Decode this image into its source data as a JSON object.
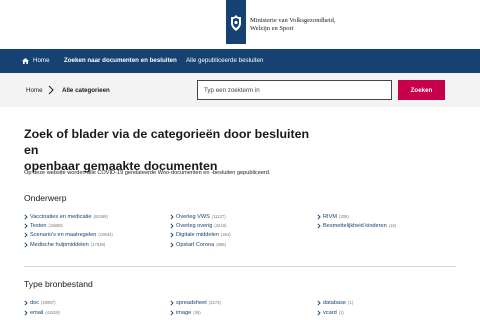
{
  "header": {
    "ministry_line1": "Ministerie van Volksgezondheid,",
    "ministry_line2": "Welzijn en Sport"
  },
  "nav": {
    "home": "Home",
    "search": "Zoeken naar documenten en besluiten",
    "all_published": "Alle gepubliceerde besluiten"
  },
  "breadcrumb": {
    "home": "Home",
    "current": "Alle categorieen"
  },
  "search": {
    "placeholder": "Typ een zoekterm in",
    "button": "Zoeken"
  },
  "main": {
    "title_line1": "Zoek of blader via de categorieën door besluiten en",
    "title_line2": "openbaar gemaakte documenten",
    "intro": "Op deze website worden alle COVID-19 gerelateerde Woo-documenten en -besluiten gepubliceerd."
  },
  "onderwerp": {
    "heading": "Onderwerp",
    "items": [
      {
        "label": "Vaccinaties en medicatie",
        "count": "(62459)"
      },
      {
        "label": "Testen",
        "count": "(15858)"
      },
      {
        "label": "Scenario's en maatregelen",
        "count": "(10944)"
      },
      {
        "label": "Medische hulpmiddelen",
        "count": "(17539)"
      },
      {
        "label": "Overleg VWS",
        "count": "(11127)"
      },
      {
        "label": "Overleg overig",
        "count": "(3219)"
      },
      {
        "label": "Digitale middelen",
        "count": "(464)"
      },
      {
        "label": "Opstart Corona",
        "count": "(856)"
      },
      {
        "label": "RIVM",
        "count": "(209)"
      },
      {
        "label": "Besmettelijkheid kinderen",
        "count": "(16)"
      }
    ]
  },
  "bronbestand": {
    "heading": "Type bronbestand",
    "items": [
      {
        "label": "doc",
        "count": "(40897)"
      },
      {
        "label": "email",
        "count": "(41819)"
      },
      {
        "label": "spreadsheet",
        "count": "(2273)"
      },
      {
        "label": "image",
        "count": "(36)"
      },
      {
        "label": "database",
        "count": "(1)"
      },
      {
        "label": "vcard",
        "count": "(1)"
      }
    ]
  },
  "colors": {
    "brand_blue": "#154273",
    "accent_pink": "#c6004a"
  }
}
